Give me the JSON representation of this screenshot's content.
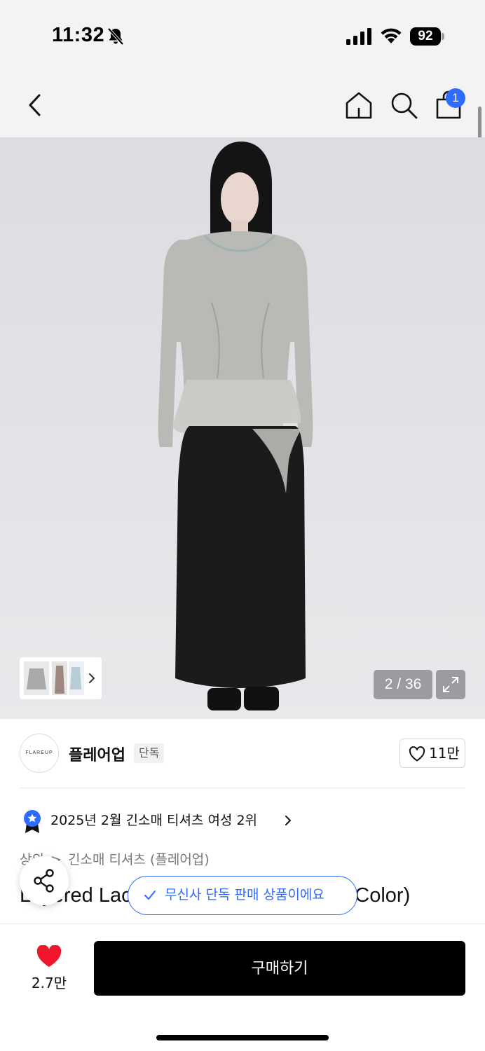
{
  "status_bar": {
    "time": "11:32",
    "battery": "92",
    "icons": [
      "bell-slash-icon",
      "signal-icon",
      "wifi-icon",
      "battery-icon"
    ]
  },
  "nav": {
    "icons": [
      "back-chevron-icon",
      "home-icon",
      "search-icon",
      "shopping-bag-icon"
    ],
    "cart_badge": "1"
  },
  "gallery": {
    "counter": "2 / 36",
    "expand_icon": "expand-arrows-icon",
    "thumbnail_icon": "chevron-right-icon"
  },
  "brand": {
    "logo_text": "FLAREUP",
    "name": "플레어업",
    "tag": "단독",
    "like_count": "11만"
  },
  "ranking": {
    "text": "2025년 2월 긴소매 티셔츠 여성 2위",
    "badge_color": "#2f6bff"
  },
  "breadcrumb": {
    "category": "상의",
    "separator": ">",
    "subcategory": "긴소매 티셔츠 (플레어업)"
  },
  "product": {
    "title": "Layered Lace Peplum Tee (FL-137_3Color)"
  },
  "toast": {
    "text": "무신사 단독 판매 상품이에요",
    "color": "#2f6bff"
  },
  "bottom_bar": {
    "wish_count": "2.7만",
    "buy_label": "구매하기",
    "heart_color": "#f0162b"
  }
}
